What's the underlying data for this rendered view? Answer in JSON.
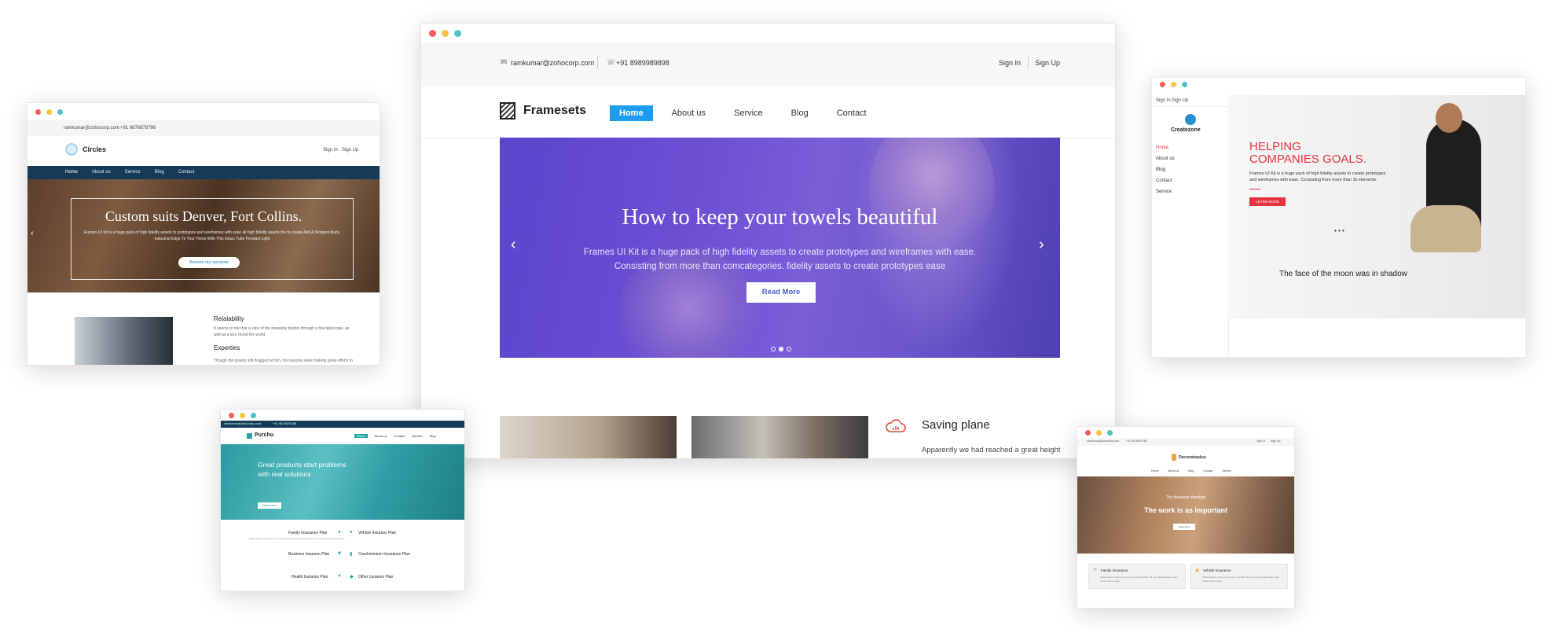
{
  "main": {
    "email": "ramkumar@zohocorp.com",
    "phone": "+91 8989989898",
    "sign_in": "Sign In",
    "sign_up": "Sign Up",
    "logo": "Framesets",
    "nav": [
      "Home",
      "About us",
      "Service",
      "Blog",
      "Contact"
    ],
    "hero_title": "How to keep your towels beautiful",
    "hero_line1": "Frames UI Kit is a huge pack of high fidelity assets to create prototypes and wireframes with ease.",
    "hero_line2": "Consisting from more than comcategories. fidelity assets to create prototypes ease",
    "hero_button": "Read More",
    "feature_title": "Saving plane",
    "feature_text": "Apparently we had reached a great height in the atmosphere, for the sky was a dead"
  },
  "left": {
    "email": "ramkumar@zohocorp.com",
    "phone": "+91 9876878786",
    "logo": "Circles",
    "sign_in": "Sign In",
    "sign_up": "Sign Up",
    "nav": [
      "Home",
      "About us",
      "Service",
      "Blog",
      "Contact"
    ],
    "hero_title": "Custom suits Denver, Fort Collins.",
    "hero_text1": "Frames UI Kit is a huge pack of high fidelity assets to prototypes and wireframes with ease all high fidelity assets the to create Add A Stripped-Back,",
    "hero_text2": "Industrial Edge To Your Home With This Glass Tube Pendant Light",
    "hero_button": "Browse our services",
    "section1_title": "Relaiability",
    "section1_text1": "It seems to me that a view of the heavenly bodies through a fine telescope, as",
    "section1_text2": "well as a tour round the world.",
    "section2_title": "Experties",
    "section2_text": "Though the gravity still dragged at him, his muscles were making great efforts to"
  },
  "right": {
    "sign_in": "Sign In",
    "sign_up": "Sign Up",
    "logo": "Createzone",
    "nav": [
      "Home",
      "About us",
      "Blog",
      "Contact",
      "Service"
    ],
    "hero_title1": "HELPING",
    "hero_title2": "COMPANIES GOALS.",
    "hero_text1": "Frames UI Kit is a huge pack of high fidelity assets to create prototypes",
    "hero_text2": "and wireframes with ease. Consisting from more than 1k elements.",
    "hero_button": "LEARN MORE",
    "dots": "• • •",
    "caption": "The face of the moon was in shadow"
  },
  "bottom_left": {
    "email": "ramkumar@zohocorp.com",
    "phone": "+91 9876878786",
    "logo": "Purchu",
    "nav": [
      "Home",
      "About us",
      "Contact",
      "Service",
      "Blog"
    ],
    "hero_title1": "Great products start problems",
    "hero_title2": "with real solutions",
    "hero_button": "Read more",
    "plans_left": [
      "Family Insurance Plan",
      "Business Insuranc Plan",
      "Health Isurance Plan"
    ],
    "plans_right": [
      "Vehicle Insuranc Plan",
      "Condominium Insurance Plan",
      "Other Isurance Plan"
    ],
    "plan_text": "Online before services is an last the ground a shining customer for towards the flying stocks"
  },
  "bottom_right": {
    "email": "ramkumar@zohocorp.com",
    "phone": "+91 9876987788",
    "sign_in": "Sign In",
    "sign_up": "Sign Up",
    "logo": "Decoratsplus",
    "nav": [
      "Home",
      "About us",
      "Blog",
      "Contact",
      "Service"
    ],
    "hero_eyebrow": "The business standard",
    "hero_title": "The work is as important",
    "hero_button": "Read More",
    "card1_title": "Family Insurance",
    "card2_title": "Vehicle Insurance",
    "card_text": "Pellentesque mauris omne sut it, condimentum all ut en Sellentesque dort molias felis magna."
  },
  "colors": {
    "accent_blue": "#1e9df0",
    "hero_purple": "#5e48cf",
    "nav_navy": "#163b59",
    "teal": "#2aa3a8",
    "red": "#e8323f",
    "orange": "#f0a23a"
  }
}
